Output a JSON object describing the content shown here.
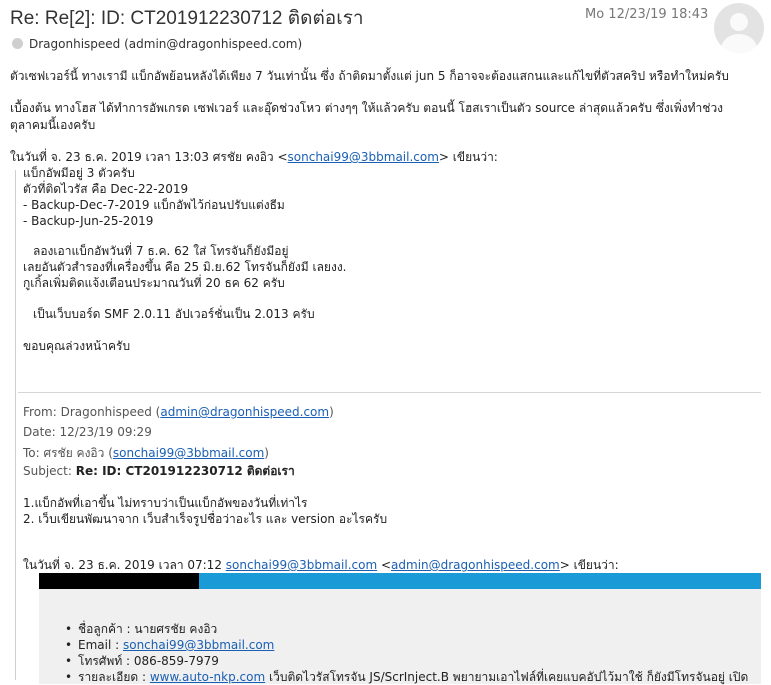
{
  "header": {
    "subject": "Re: Re[2]: ID: CT201912230712 ติดต่อเรา",
    "date": "Mo 12/23/19 18:43",
    "sender": "Dragonhispeed (admin@dragonhispeed.com)"
  },
  "message": {
    "para1": "ตัวเซฟเวอร์นี้ ทางเรามี แบ็กอัพย้อนหลังได้เพียง 7 วันเท่านั้น ซึ่ง ถ้าติดมาตั้งแต่ jun 5 ก็อาจจะต้องแสกนและแก้ไขที่ตัวสคริป หรือทำใหม่ครับ",
    "para2": "เบื้องต้น ทางโฮส ได้ทำการอัพเกรด เซฟเวอร์ และอุ๊ดช่วงโหว ต่างๆๆ ให้แล้วครับ    ตอนนี้ โฮสเราเป็นตัว source ล่าสุดแล้วครับ ซึ่งเพิ่งทำช่วง ตุลาคมนี้เองครับ"
  },
  "quote1": {
    "intro_prefix": "ในวันที่ จ. 23 ธ.ค. 2019 เวลา 13:03 ศรชัย คงอิว <",
    "intro_email": "sonchai99@3bbmail.com",
    "intro_suffix": "> เขียนว่า:",
    "lines": [
      "แบ็กอัพมีอยู่ 3 ตัวครับ",
      "ตัวที่ติดไวรัส คือ Dec-22-2019",
      "- Backup-Dec-7-2019 แบ็กอัพไว้ก่อนปรับแต่งธีม",
      "- Backup-Jun-25-2019"
    ],
    "para_a1": "ลองเอาแบ็กอัพวันที่ 7 ธ.ค. 62 ใส่ โทรจันก็ยังมีอยู่",
    "para_a2": "เลยอันตัวสำรองที่เครื่องขึ้น คือ 25 มิ.ย.62 โทรจันก็ยังมี เลยงง.",
    "para_a3": "กูเกิ้ลเพิ่มติดแจ้งเตือนประมาณวันที่ 20 ธค 62 ครับ",
    "para_b": "เป็นเว็บบอร์ด SMF 2.0.11 อัปเวอร์ชั่นเป็น 2.013 ครับ",
    "thanks": "ขอบคุณล่วงหน้าครับ"
  },
  "forwarded": {
    "from_label": "From: Dragonhispeed (",
    "from_email": "admin@dragonhispeed.com",
    "from_suffix": ")",
    "date_line": "Date: 12/23/19 09:29",
    "to_label": "To: ศรชัย คงอิว (",
    "to_email": "sonchai99@3bbmail.com",
    "to_suffix": ")",
    "subject_label": "Subject: ",
    "subject_value": "Re: ID: CT201912230712 ติดต่อเรา",
    "line1": "1.แบ็กอัพที่เอาขึ้น ไม่ทราบว่าเป็นแบ็กอัพของวันที่เท่าไร",
    "line2": "2. เว็บเขียนพัฒนาจาก เว็บสำเร็จรูปชื่อว่าอะไร และ version อะไรครับ",
    "intro2_prefix": "ในวันที่ จ. 23 ธ.ค. 2019 เวลา 07:12 ",
    "intro2_email1": "sonchai99@3bbmail.com",
    "intro2_mid": " <",
    "intro2_email2": "admin@dragonhispeed.com",
    "intro2_suffix": "> เขียนว่า:"
  },
  "form": {
    "name_line": "ชื่อลูกค้า : นายศรชัย คงอิว",
    "email_label": "Email : ",
    "email_value": "sonchai99@3bbmail.com",
    "phone_line": "โทรศัพท์ : 086-859-7979",
    "detail_label": "รายละเอียด : ",
    "detail_link": "www.auto-nkp.com",
    "detail_text": " เว็บติดไวรัสโทรจัน JS/ScrInject.B พยายามเอาไฟล์ที่เคยแบคอัปไว้มาใช้ ก็ยังมีโทรจันอยู่ เปิด"
  },
  "colors": {
    "link": "#1a5fb4",
    "banner_black": "#000000",
    "banner_blue": "#1a9bd7",
    "box_bg": "#f0f0f0"
  }
}
